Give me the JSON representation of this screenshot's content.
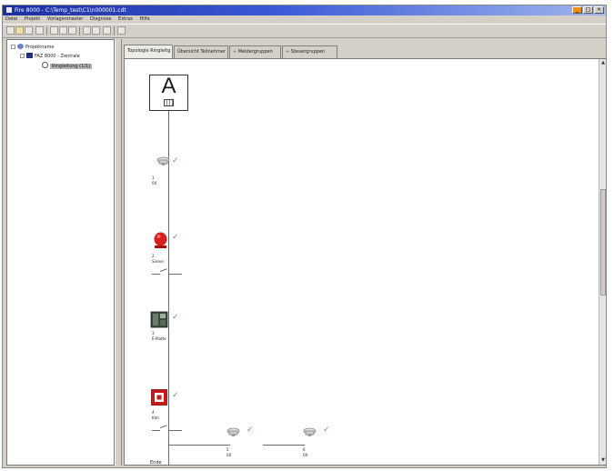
{
  "window": {
    "title": "Fire 8000 - C:\\Temp_test\\C1\\n000001.cdt",
    "controls": [
      "_",
      "□",
      "×"
    ]
  },
  "menu": [
    "Datei",
    "Projekt",
    "Vorlagenmaster",
    "Diagnose",
    "Extras",
    "Hilfe"
  ],
  "toolbar_icons": [
    "new-icon",
    "open-icon",
    "save-icon",
    "print-icon",
    "cut-icon",
    "copy-icon",
    "paste-icon",
    "undo-icon",
    "redo-icon",
    "zoom-icon",
    "help-icon"
  ],
  "tree": {
    "root": "Projektname",
    "panel": "FAZ 8000 - Zentrale",
    "selected": "Ringleitung (1/1)"
  },
  "tabs": [
    "Topologie Ringleitg",
    "Übersicht Teilnehmer",
    "Meldergruppen",
    "Steuergruppen"
  ],
  "devices": [
    {
      "id": "panel",
      "letter": "A"
    },
    {
      "number": "1",
      "sub": "0X",
      "icon": "smoke-detector-icon"
    },
    {
      "number": "2",
      "sub": "Sirene",
      "icon": "siren-icon"
    },
    {
      "number": "3",
      "sub": "E-Platte",
      "icon": "io-module-icon"
    },
    {
      "number": "4",
      "sub": "Klm",
      "icon": "call-point-icon"
    },
    {
      "number": "5",
      "sub": "0X",
      "icon": "smoke-detector-icon"
    },
    {
      "number": "6",
      "sub": "0X",
      "icon": "smoke-detector-icon"
    }
  ],
  "bottom_label": "Ende"
}
